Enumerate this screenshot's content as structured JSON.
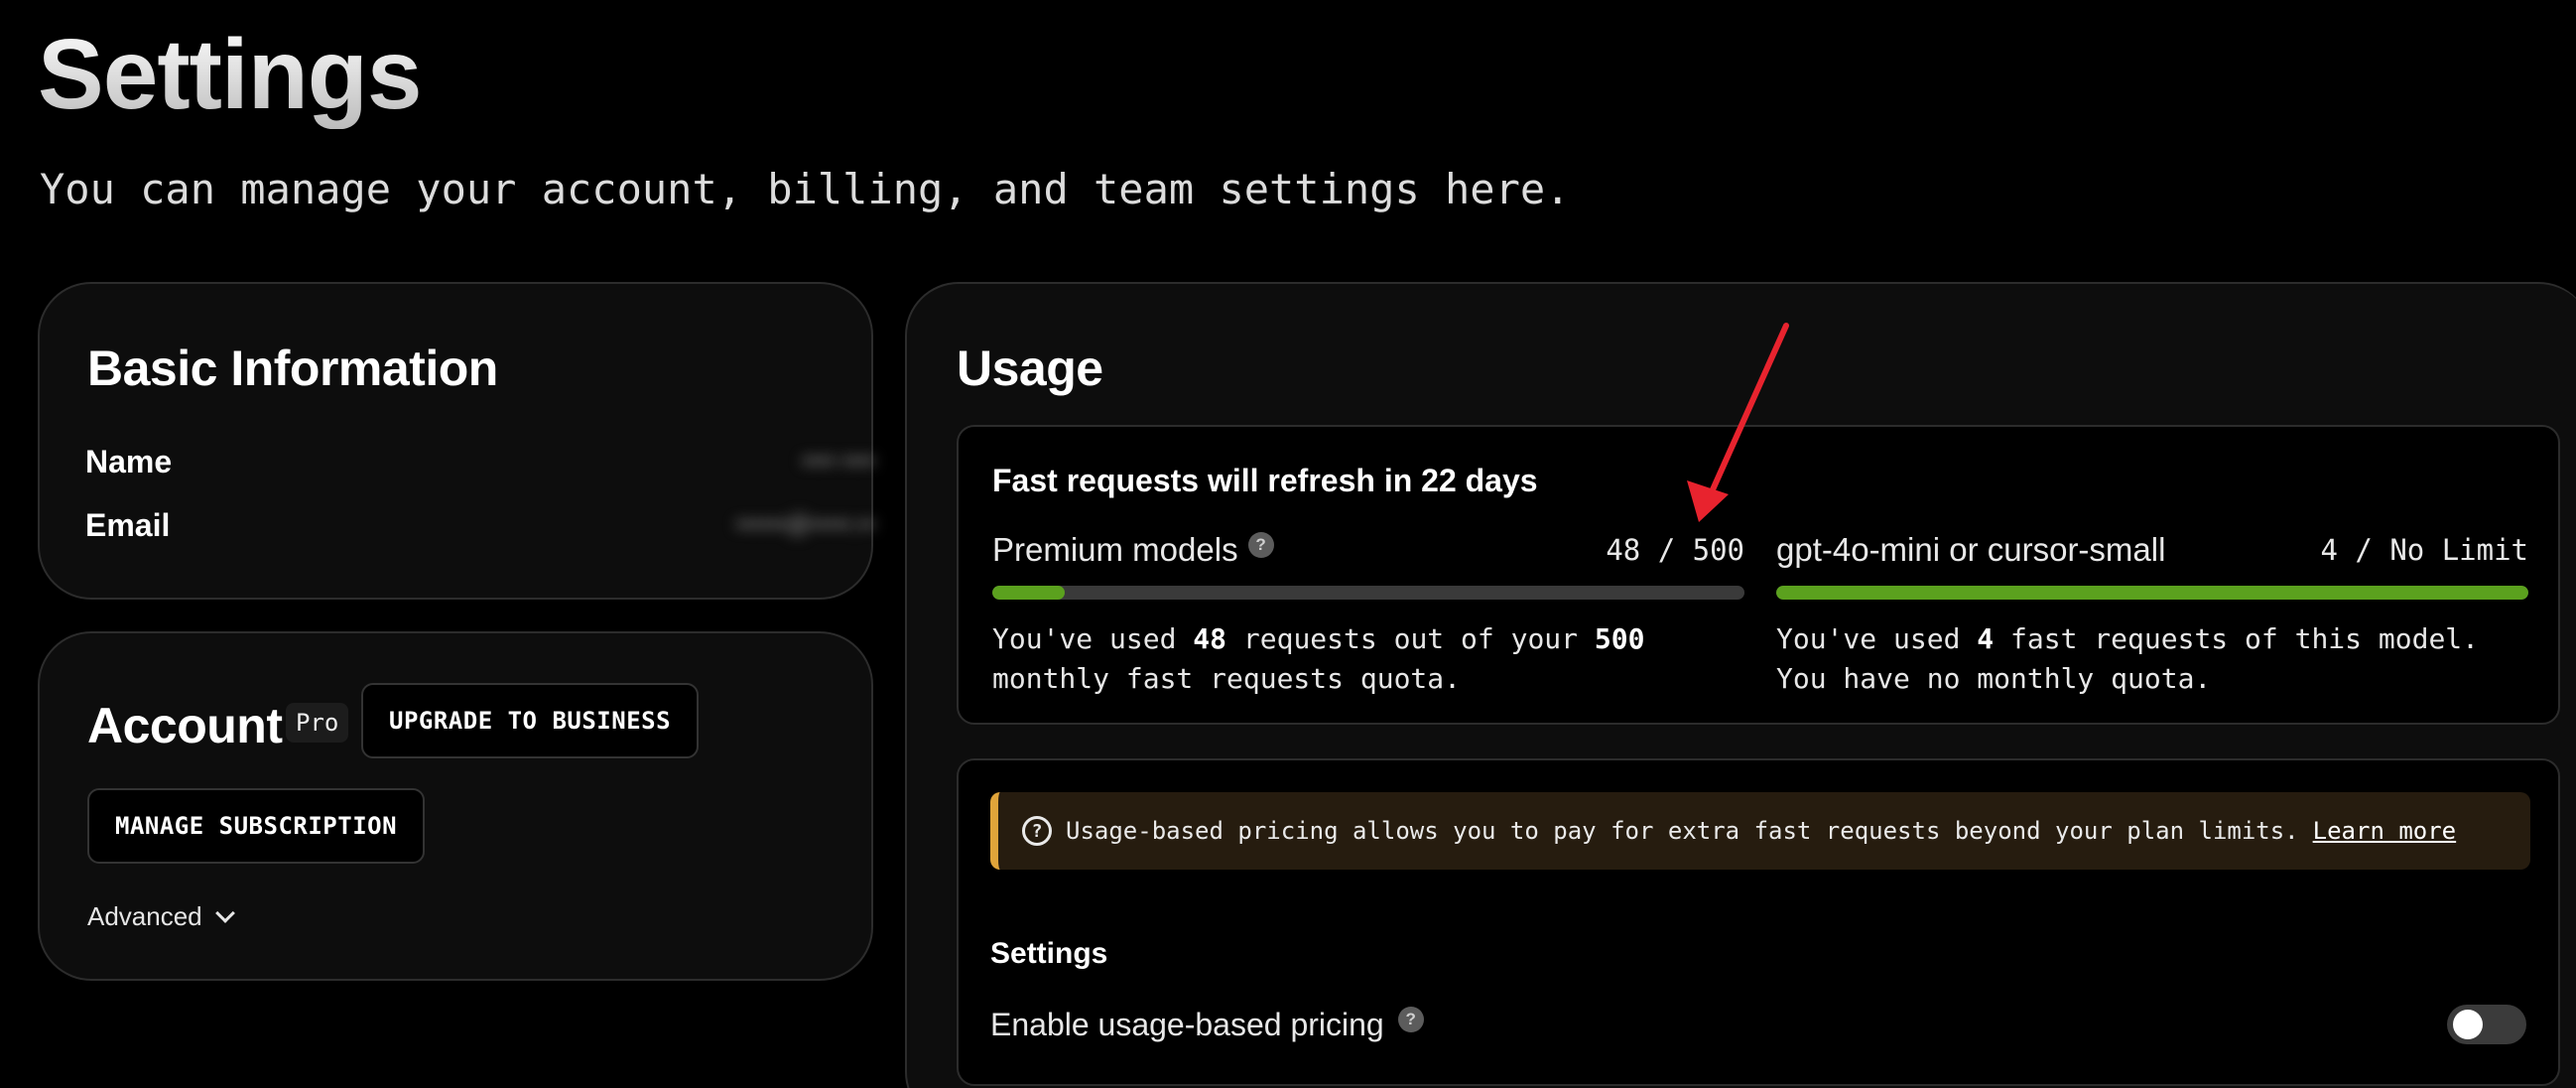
{
  "header": {
    "title": "Settings",
    "subtitle": "You can manage your account, billing, and team settings here."
  },
  "basic_info": {
    "title": "Basic Information",
    "name_label": "Name",
    "name_value": "•••• ••••",
    "email_label": "Email",
    "email_value": "••••••@•••••.••"
  },
  "account": {
    "title": "Account",
    "plan_badge": "Pro",
    "upgrade_label": "UPGRADE TO BUSINESS",
    "manage_label": "MANAGE SUBSCRIPTION",
    "advanced_label": "Advanced"
  },
  "usage": {
    "title": "Usage",
    "refresh_text": "Fast requests will refresh in 22 days",
    "quotas": [
      {
        "name": "Premium models",
        "count": "48 / 500",
        "fill_fraction": 0.096,
        "desc_pre": "You've used ",
        "desc_used": "48",
        "desc_mid": " requests out of your ",
        "desc_limit": "500",
        "desc_post": " monthly fast requests quota."
      },
      {
        "name": "gpt-4o-mini or cursor-small",
        "count": "4 / No Limit",
        "fill_fraction": 1.0,
        "desc_pre": "You've used ",
        "desc_used": "4",
        "desc_post": " fast requests of this model. You have no monthly quota."
      }
    ],
    "notice_text": "Usage-based pricing allows you to pay for extra fast requests beyond your plan limits.",
    "learn_more": "Learn more",
    "settings_heading": "Settings",
    "toggle_label": "Enable usage-based pricing",
    "toggle_on": false
  },
  "colors": {
    "bar_fill": "#5ba11e",
    "bar_track": "#3a3a3a",
    "notice_accent": "#e0a43a",
    "annotation_arrow": "#e8232e"
  }
}
